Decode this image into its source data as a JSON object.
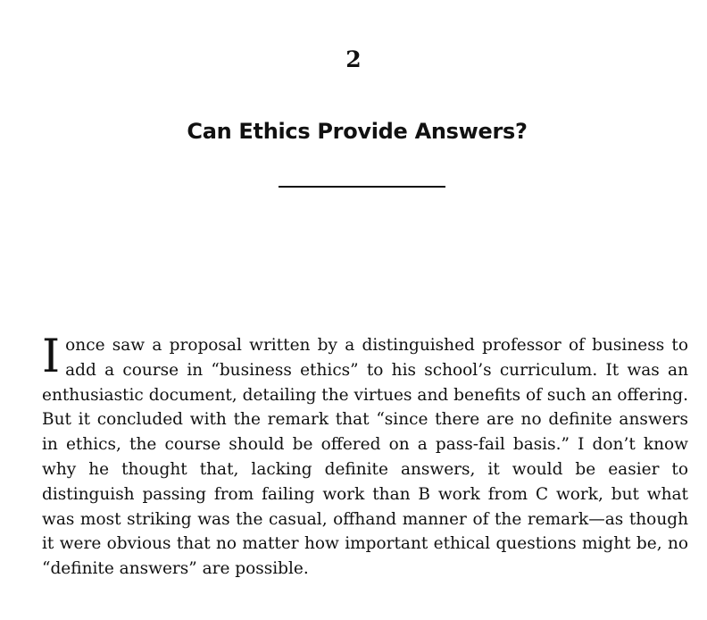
{
  "chapter": {
    "number": "2",
    "title": "Can Ethics Provide Answers?"
  },
  "body": {
    "drop_cap": "I",
    "paragraph": "once saw a proposal written by a distinguished professor of business to add a course in “business ethics” to his school’s curriculum. It was an enthusiastic document, detailing the virtues and benefits of such an offering. But it concluded with the remark that “since there are no definite answers in ethics, the course should be offered on a pass-fail basis.” I don’t know why he thought that, lacking definite answers, it would be easier to distinguish passing from failing work than B work from C work, but what was most striking was the casual, offhand manner of the remark—as though it were obvious that no matter how important ethical questions might be, no “definite answers” are possible."
  }
}
